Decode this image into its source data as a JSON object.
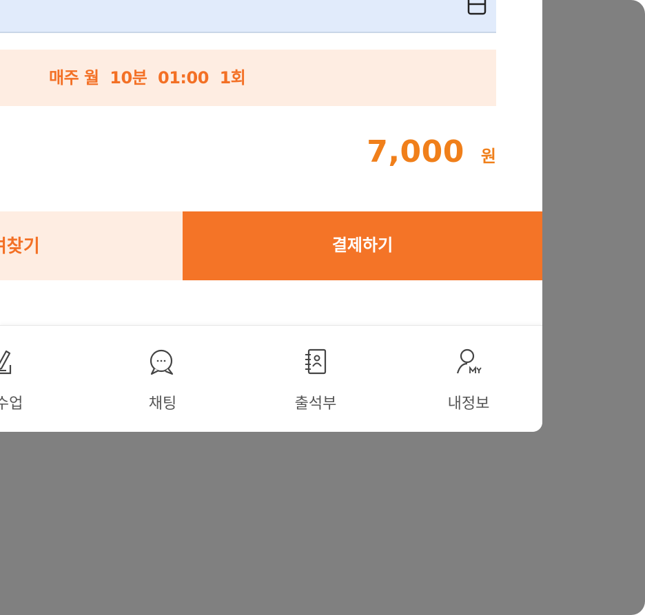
{
  "schedule": {
    "text": "매주 월  10분  01:00  1회"
  },
  "price": {
    "value": "7,000",
    "unit": "원"
  },
  "actions": {
    "left_label": "여찾기",
    "pay_label": "결제하기"
  },
  "bottom_nav": {
    "items": [
      {
        "label": "쉬수업",
        "icon": "edit-note-icon"
      },
      {
        "label": "채팅",
        "icon": "chat-bubble-icon"
      },
      {
        "label": "출석부",
        "icon": "attendance-book-icon"
      },
      {
        "label": "내정보",
        "icon": "my-profile-icon"
      }
    ]
  },
  "colors": {
    "accent_orange": "#f47427",
    "price_orange": "#f07f1a",
    "highlight_bg": "#feede2",
    "input_bg": "#e1ebfb",
    "outer_bg": "#808080"
  }
}
